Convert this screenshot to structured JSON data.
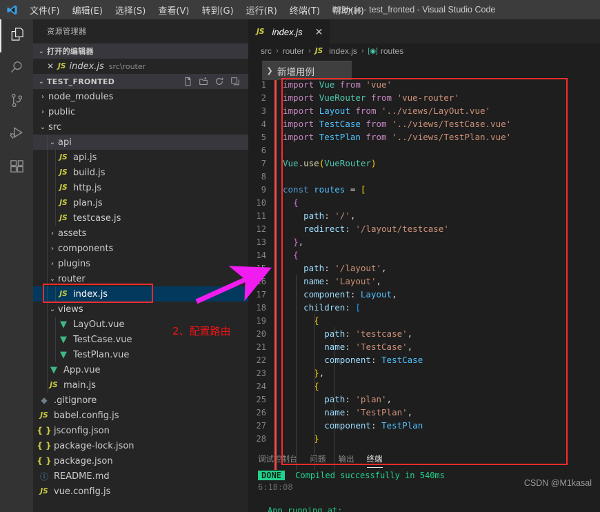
{
  "titlebar": {
    "logo_icon": "vscode-logo-icon",
    "menus": [
      {
        "label": "文件(F)",
        "mnemonic": "F"
      },
      {
        "label": "编辑(E)",
        "mnemonic": "E"
      },
      {
        "label": "选择(S)",
        "mnemonic": "S"
      },
      {
        "label": "查看(V)",
        "mnemonic": "V"
      },
      {
        "label": "转到(G)",
        "mnemonic": "G"
      },
      {
        "label": "运行(R)",
        "mnemonic": "R"
      },
      {
        "label": "终端(T)",
        "mnemonic": "T"
      },
      {
        "label": "帮助(H)",
        "mnemonic": "H"
      }
    ],
    "window_title": "index.js - test_fronted - Visual Studio Code"
  },
  "activitybar": {
    "items": [
      {
        "name": "explorer",
        "icon": "files-icon",
        "active": true
      },
      {
        "name": "search",
        "icon": "search-icon",
        "active": false
      },
      {
        "name": "source-control",
        "icon": "source-control-icon",
        "active": false
      },
      {
        "name": "run-debug",
        "icon": "run-and-debug-icon",
        "active": false
      },
      {
        "name": "extensions",
        "icon": "extensions-icon",
        "active": false
      }
    ]
  },
  "sidebar": {
    "title": "资源管理器",
    "open_editors": {
      "header": "打开的编辑器",
      "twisty": "⌄",
      "items": [
        {
          "close_icon": "close-icon",
          "file_icon": "js-icon",
          "name": "index.js",
          "description": "src\\router"
        }
      ]
    },
    "project": {
      "header": "TEST_FRONTED",
      "twisty": "⌄",
      "actions": [
        {
          "name": "new-file-button",
          "icon": "new-file-icon"
        },
        {
          "name": "new-folder-button",
          "icon": "new-folder-icon"
        },
        {
          "name": "refresh-button",
          "icon": "refresh-icon"
        },
        {
          "name": "collapse-all-button",
          "icon": "collapse-all-icon"
        }
      ]
    },
    "tree": [
      {
        "label": "node_modules",
        "kind": "folder",
        "depth": 1,
        "expanded": false,
        "icon": "chevron-right-icon"
      },
      {
        "label": "public",
        "kind": "folder",
        "depth": 1,
        "expanded": false,
        "icon": "chevron-right-icon"
      },
      {
        "label": "src",
        "kind": "folder",
        "depth": 1,
        "expanded": true,
        "icon": "chevron-down-icon"
      },
      {
        "label": "api",
        "kind": "folder",
        "depth": 2,
        "expanded": true,
        "icon": "chevron-down-icon",
        "highlight": true
      },
      {
        "label": "api.js",
        "kind": "js",
        "depth": 3
      },
      {
        "label": "build.js",
        "kind": "js",
        "depth": 3
      },
      {
        "label": "http.js",
        "kind": "js",
        "depth": 3
      },
      {
        "label": "plan.js",
        "kind": "js",
        "depth": 3
      },
      {
        "label": "testcase.js",
        "kind": "js",
        "depth": 3
      },
      {
        "label": "assets",
        "kind": "folder",
        "depth": 2,
        "expanded": false,
        "icon": "chevron-right-icon"
      },
      {
        "label": "components",
        "kind": "folder",
        "depth": 2,
        "expanded": false,
        "icon": "chevron-right-icon"
      },
      {
        "label": "plugins",
        "kind": "folder",
        "depth": 2,
        "expanded": false,
        "icon": "chevron-right-icon"
      },
      {
        "label": "router",
        "kind": "folder",
        "depth": 2,
        "expanded": true,
        "icon": "chevron-down-icon"
      },
      {
        "label": "index.js",
        "kind": "js",
        "depth": 3,
        "selected": true
      },
      {
        "label": "views",
        "kind": "folder",
        "depth": 2,
        "expanded": true,
        "icon": "chevron-down-icon"
      },
      {
        "label": "LayOut.vue",
        "kind": "vue",
        "depth": 3
      },
      {
        "label": "TestCase.vue",
        "kind": "vue",
        "depth": 3
      },
      {
        "label": "TestPlan.vue",
        "kind": "vue",
        "depth": 3
      },
      {
        "label": "App.vue",
        "kind": "vue",
        "depth": 2
      },
      {
        "label": "main.js",
        "kind": "js",
        "depth": 2
      },
      {
        "label": ".gitignore",
        "kind": "git",
        "depth": 1
      },
      {
        "label": "babel.config.js",
        "kind": "js",
        "depth": 1
      },
      {
        "label": "jsconfig.json",
        "kind": "json",
        "depth": 1
      },
      {
        "label": "package-lock.json",
        "kind": "json",
        "depth": 1
      },
      {
        "label": "package.json",
        "kind": "json",
        "depth": 1
      },
      {
        "label": "README.md",
        "kind": "md",
        "depth": 1
      },
      {
        "label": "vue.config.js",
        "kind": "js",
        "depth": 1
      }
    ]
  },
  "editor": {
    "tab": {
      "icon": "js-icon",
      "name": "index.js",
      "close_icon": "close-icon"
    },
    "breadcrumb": [
      {
        "label": "src",
        "icon": null
      },
      {
        "label": "router",
        "icon": null
      },
      {
        "label": "index.js",
        "icon": "js-icon"
      },
      {
        "label": "routes",
        "icon": "symbol-variable-icon"
      }
    ],
    "breadcrumb_separator": "›",
    "code_lines": [
      {
        "n": 1,
        "tokens": [
          {
            "t": "import ",
            "c": "t-kw"
          },
          {
            "t": "Vue",
            "c": "t-cls"
          },
          {
            "t": " from ",
            "c": "t-kw"
          },
          {
            "t": "'vue'",
            "c": "t-str"
          }
        ]
      },
      {
        "n": 2,
        "tokens": [
          {
            "t": "import ",
            "c": "t-kw"
          },
          {
            "t": "VueRouter",
            "c": "t-cls"
          },
          {
            "t": " from ",
            "c": "t-kw"
          },
          {
            "t": "'vue-router'",
            "c": "t-str"
          }
        ]
      },
      {
        "n": 3,
        "tokens": [
          {
            "t": "import ",
            "c": "t-kw"
          },
          {
            "t": "Layout",
            "c": "t-var"
          },
          {
            "t": " from ",
            "c": "t-kw"
          },
          {
            "t": "'../views/LayOut.vue'",
            "c": "t-str"
          }
        ]
      },
      {
        "n": 4,
        "tokens": [
          {
            "t": "import ",
            "c": "t-kw"
          },
          {
            "t": "TestCase",
            "c": "t-var"
          },
          {
            "t": " from ",
            "c": "t-kw"
          },
          {
            "t": "'../views/TestCase.vue'",
            "c": "t-str"
          }
        ]
      },
      {
        "n": 5,
        "tokens": [
          {
            "t": "import ",
            "c": "t-kw"
          },
          {
            "t": "TestPlan",
            "c": "t-var"
          },
          {
            "t": " from ",
            "c": "t-kw"
          },
          {
            "t": "'../views/TestPlan.vue'",
            "c": "t-str"
          }
        ]
      },
      {
        "n": 6,
        "tokens": []
      },
      {
        "n": 7,
        "tokens": [
          {
            "t": "Vue",
            "c": "t-cls"
          },
          {
            "t": ".",
            "c": "t-pl"
          },
          {
            "t": "use",
            "c": "t-fn"
          },
          {
            "t": "(",
            "c": "t-br1"
          },
          {
            "t": "VueRouter",
            "c": "t-cls"
          },
          {
            "t": ")",
            "c": "t-br1"
          }
        ]
      },
      {
        "n": 8,
        "tokens": []
      },
      {
        "n": 9,
        "tokens": [
          {
            "t": "const ",
            "c": "t-kw2"
          },
          {
            "t": "routes",
            "c": "t-var"
          },
          {
            "t": " = ",
            "c": "t-pl"
          },
          {
            "t": "[",
            "c": "t-br1"
          }
        ]
      },
      {
        "n": 10,
        "tokens": [
          {
            "t": "  ",
            "c": "t-pl"
          },
          {
            "t": "{",
            "c": "t-br2"
          }
        ]
      },
      {
        "n": 11,
        "tokens": [
          {
            "t": "    ",
            "c": "t-pl"
          },
          {
            "t": "path",
            "c": "t-prop"
          },
          {
            "t": ": ",
            "c": "t-pl"
          },
          {
            "t": "'/'",
            "c": "t-str"
          },
          {
            "t": ",",
            "c": "t-pl"
          }
        ]
      },
      {
        "n": 12,
        "tokens": [
          {
            "t": "    ",
            "c": "t-pl"
          },
          {
            "t": "redirect",
            "c": "t-prop"
          },
          {
            "t": ": ",
            "c": "t-pl"
          },
          {
            "t": "'/layout/testcase'",
            "c": "t-str"
          }
        ]
      },
      {
        "n": 13,
        "tokens": [
          {
            "t": "  ",
            "c": "t-pl"
          },
          {
            "t": "}",
            "c": "t-br2"
          },
          {
            "t": ",",
            "c": "t-pl"
          }
        ]
      },
      {
        "n": 14,
        "tokens": [
          {
            "t": "  ",
            "c": "t-pl"
          },
          {
            "t": "{",
            "c": "t-br2"
          }
        ]
      },
      {
        "n": 15,
        "tokens": [
          {
            "t": "    ",
            "c": "t-pl"
          },
          {
            "t": "path",
            "c": "t-prop"
          },
          {
            "t": ": ",
            "c": "t-pl"
          },
          {
            "t": "'/layout'",
            "c": "t-str"
          },
          {
            "t": ",",
            "c": "t-pl"
          }
        ]
      },
      {
        "n": 16,
        "tokens": [
          {
            "t": "    ",
            "c": "t-pl"
          },
          {
            "t": "name",
            "c": "t-prop"
          },
          {
            "t": ": ",
            "c": "t-pl"
          },
          {
            "t": "'Layout'",
            "c": "t-str"
          },
          {
            "t": ",",
            "c": "t-pl"
          }
        ]
      },
      {
        "n": 17,
        "tokens": [
          {
            "t": "    ",
            "c": "t-pl"
          },
          {
            "t": "component",
            "c": "t-prop"
          },
          {
            "t": ": ",
            "c": "t-pl"
          },
          {
            "t": "Layout",
            "c": "t-var"
          },
          {
            "t": ",",
            "c": "t-pl"
          }
        ]
      },
      {
        "n": 18,
        "tokens": [
          {
            "t": "    ",
            "c": "t-pl"
          },
          {
            "t": "children",
            "c": "t-prop"
          },
          {
            "t": ": ",
            "c": "t-pl"
          },
          {
            "t": "[",
            "c": "t-br3"
          }
        ]
      },
      {
        "n": 19,
        "tokens": [
          {
            "t": "      ",
            "c": "t-pl"
          },
          {
            "t": "{",
            "c": "t-br1"
          }
        ]
      },
      {
        "n": 20,
        "tokens": [
          {
            "t": "        ",
            "c": "t-pl"
          },
          {
            "t": "path",
            "c": "t-prop"
          },
          {
            "t": ": ",
            "c": "t-pl"
          },
          {
            "t": "'testcase'",
            "c": "t-str"
          },
          {
            "t": ",",
            "c": "t-pl"
          }
        ]
      },
      {
        "n": 21,
        "tokens": [
          {
            "t": "        ",
            "c": "t-pl"
          },
          {
            "t": "name",
            "c": "t-prop"
          },
          {
            "t": ": ",
            "c": "t-pl"
          },
          {
            "t": "'TestCase'",
            "c": "t-str"
          },
          {
            "t": ",",
            "c": "t-pl"
          }
        ]
      },
      {
        "n": 22,
        "tokens": [
          {
            "t": "        ",
            "c": "t-pl"
          },
          {
            "t": "component",
            "c": "t-prop"
          },
          {
            "t": ": ",
            "c": "t-pl"
          },
          {
            "t": "TestCase",
            "c": "t-var"
          }
        ]
      },
      {
        "n": 23,
        "tokens": [
          {
            "t": "      ",
            "c": "t-pl"
          },
          {
            "t": "}",
            "c": "t-br1"
          },
          {
            "t": ",",
            "c": "t-pl"
          }
        ]
      },
      {
        "n": 24,
        "tokens": [
          {
            "t": "      ",
            "c": "t-pl"
          },
          {
            "t": "{",
            "c": "t-br1"
          }
        ]
      },
      {
        "n": 25,
        "tokens": [
          {
            "t": "        ",
            "c": "t-pl"
          },
          {
            "t": "path",
            "c": "t-prop"
          },
          {
            "t": ": ",
            "c": "t-pl"
          },
          {
            "t": "'plan'",
            "c": "t-str"
          },
          {
            "t": ",",
            "c": "t-pl"
          }
        ]
      },
      {
        "n": 26,
        "tokens": [
          {
            "t": "        ",
            "c": "t-pl"
          },
          {
            "t": "name",
            "c": "t-prop"
          },
          {
            "t": ": ",
            "c": "t-pl"
          },
          {
            "t": "'TestPlan'",
            "c": "t-str"
          },
          {
            "t": ",",
            "c": "t-pl"
          }
        ]
      },
      {
        "n": 27,
        "tokens": [
          {
            "t": "        ",
            "c": "t-pl"
          },
          {
            "t": "component",
            "c": "t-prop"
          },
          {
            "t": ": ",
            "c": "t-pl"
          },
          {
            "t": "TestPlan",
            "c": "t-var"
          }
        ]
      },
      {
        "n": 28,
        "tokens": [
          {
            "t": "      ",
            "c": "t-pl"
          },
          {
            "t": "}",
            "c": "t-br1"
          }
        ]
      }
    ]
  },
  "overlay": {
    "chevron_icon": "chevron-right-icon",
    "label": "新增用例"
  },
  "panel": {
    "tabs": [
      {
        "label": "调试控制台",
        "active": false
      },
      {
        "label": "问题",
        "active": false
      },
      {
        "label": "输出",
        "active": false
      },
      {
        "label": "终端",
        "active": true
      }
    ],
    "terminal": {
      "badge": "DONE",
      "message": "Compiled successfully in 540ms",
      "timestamp": "6:18:08",
      "next_line": "App running at:"
    }
  },
  "watermark": "CSDN @M1kasal",
  "annotations": {
    "step_label": "2、配置路由",
    "rect_color": "#fb2c2c",
    "arrow_color": "#f01cf0",
    "text_color": "#f01414"
  }
}
